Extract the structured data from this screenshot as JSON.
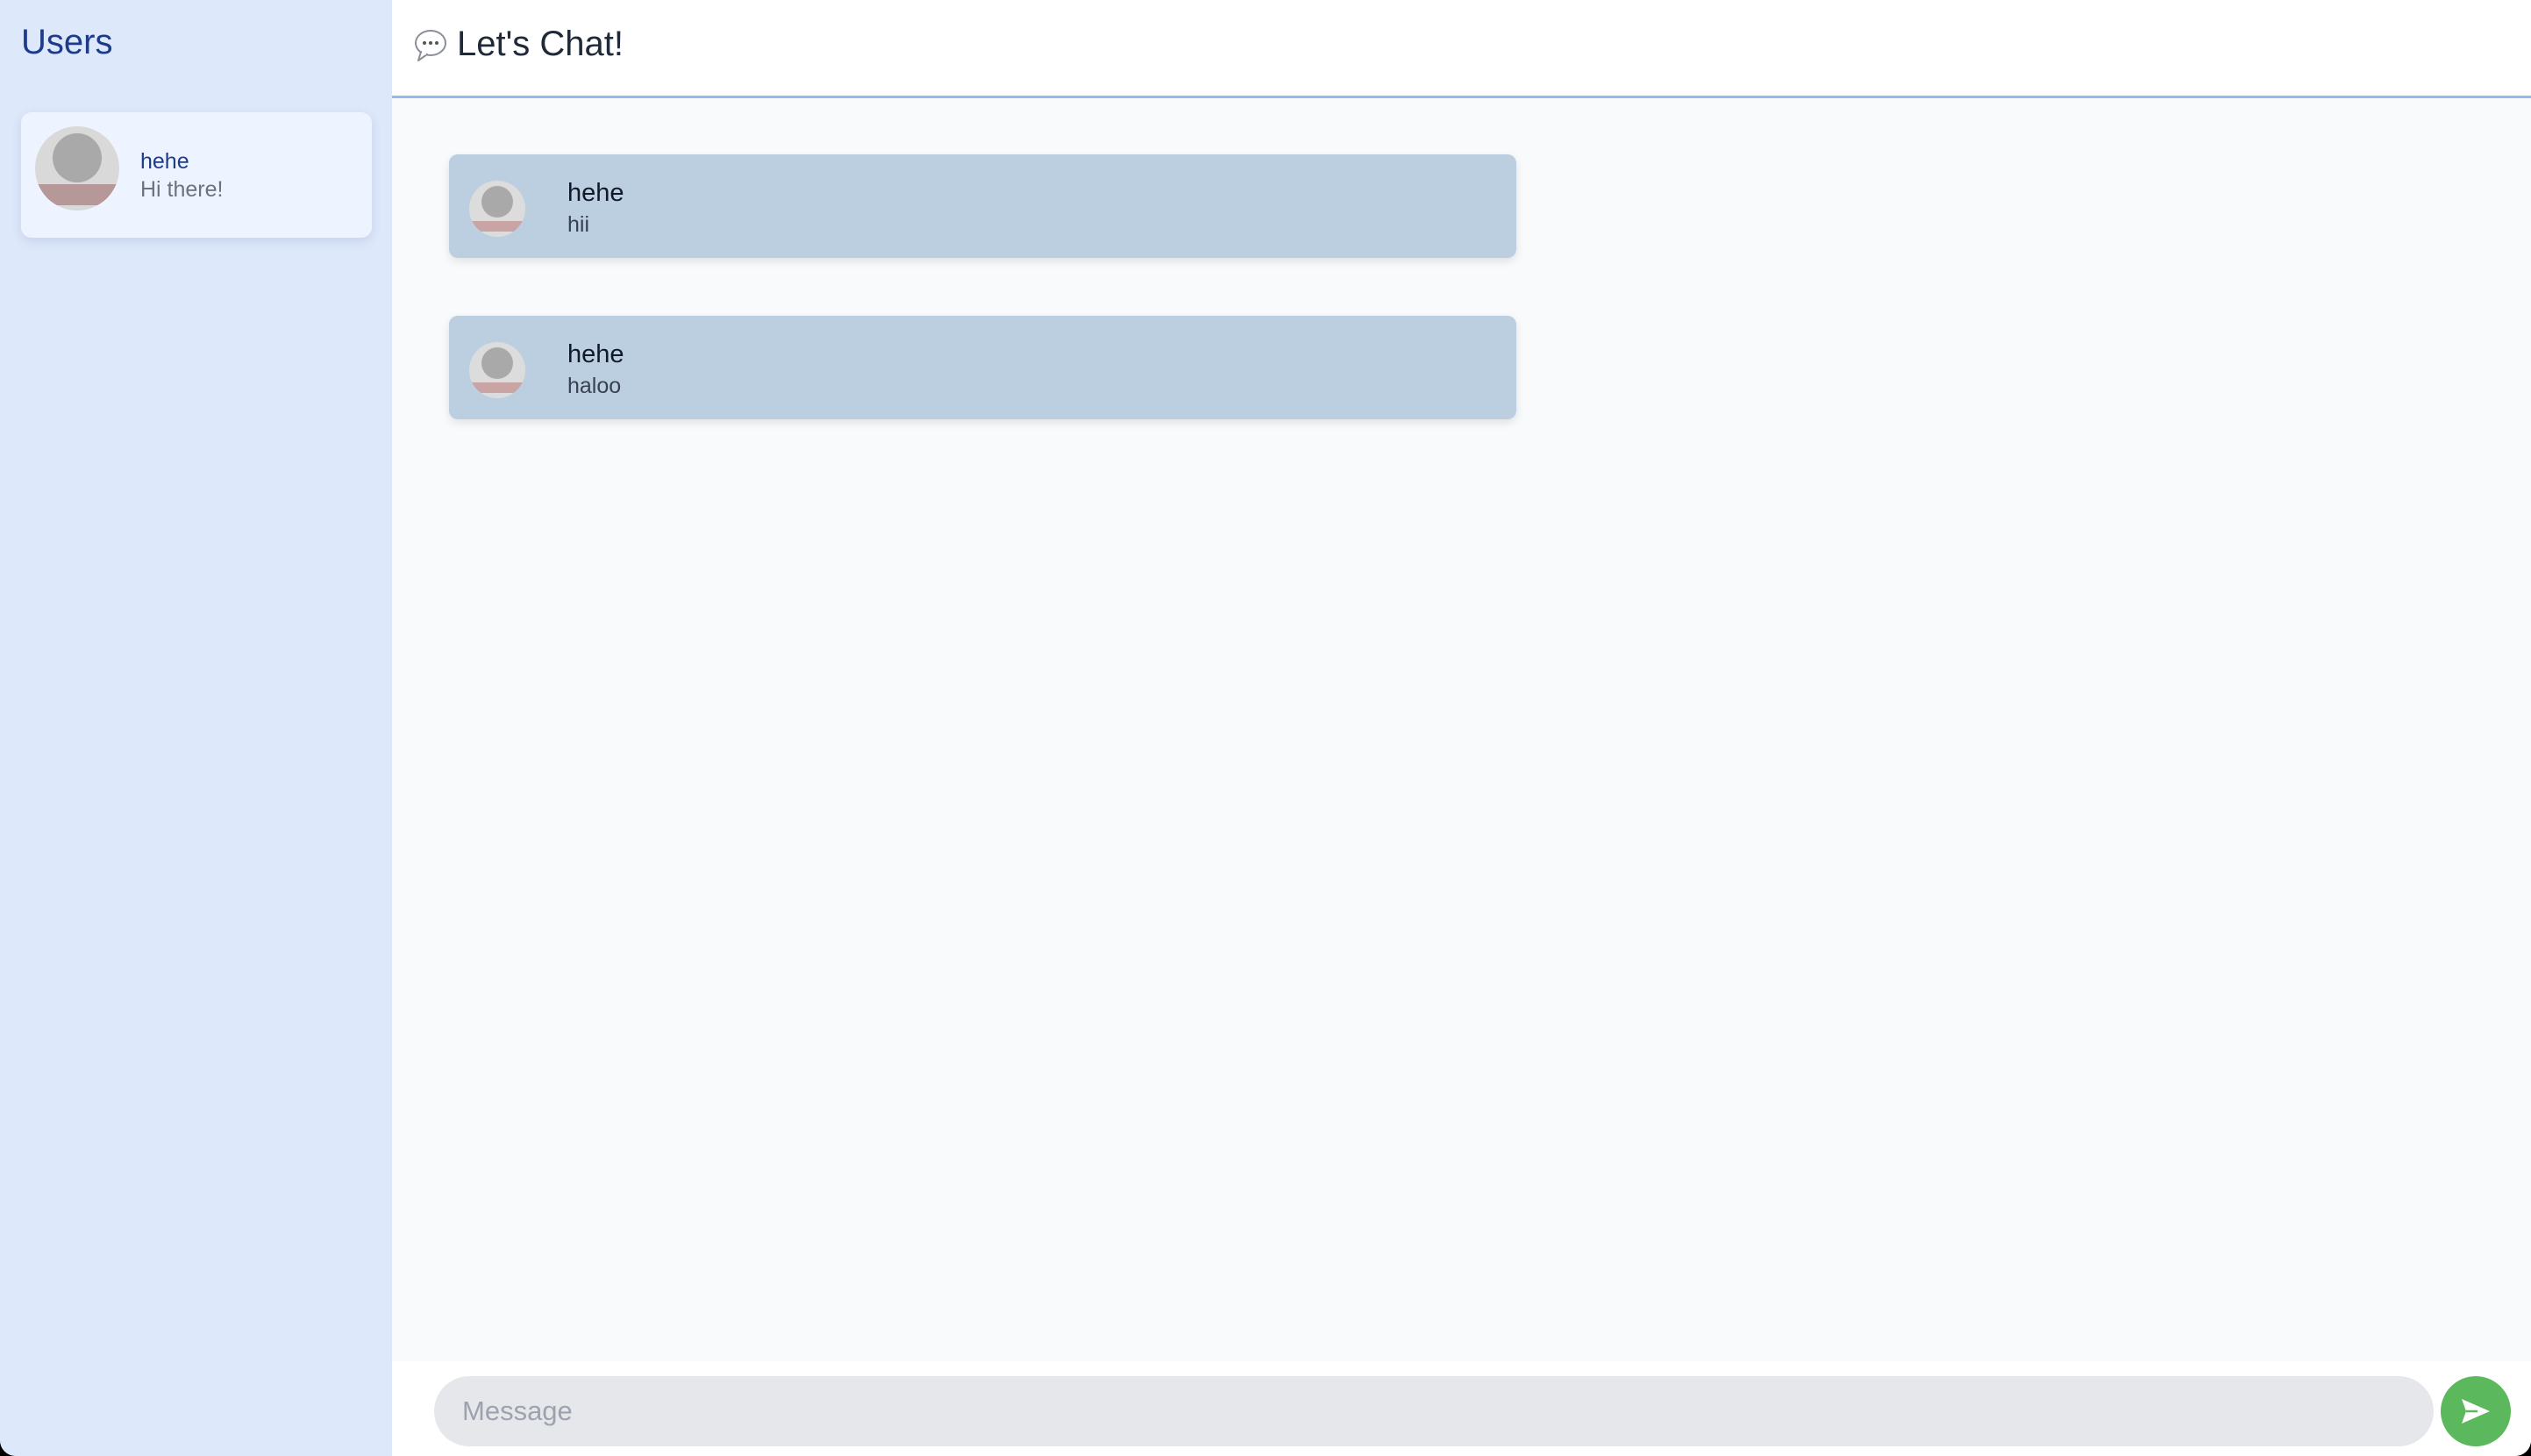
{
  "sidebar": {
    "title": "Users",
    "users": [
      {
        "name": "hehe",
        "preview": "Hi there!"
      }
    ]
  },
  "header": {
    "icon": "speech-bubble-icon",
    "title": "Let's Chat!"
  },
  "messages": [
    {
      "sender": "hehe",
      "text": "hii"
    },
    {
      "sender": "hehe",
      "text": "haloo"
    }
  ],
  "composer": {
    "placeholder": "Message",
    "value": "",
    "send_icon": "send-icon"
  },
  "colors": {
    "sidebar_bg": "#dde8fa",
    "accent_blue": "#1e3a8a",
    "message_bg": "#bccfe1",
    "send_button": "#5cb85c"
  }
}
